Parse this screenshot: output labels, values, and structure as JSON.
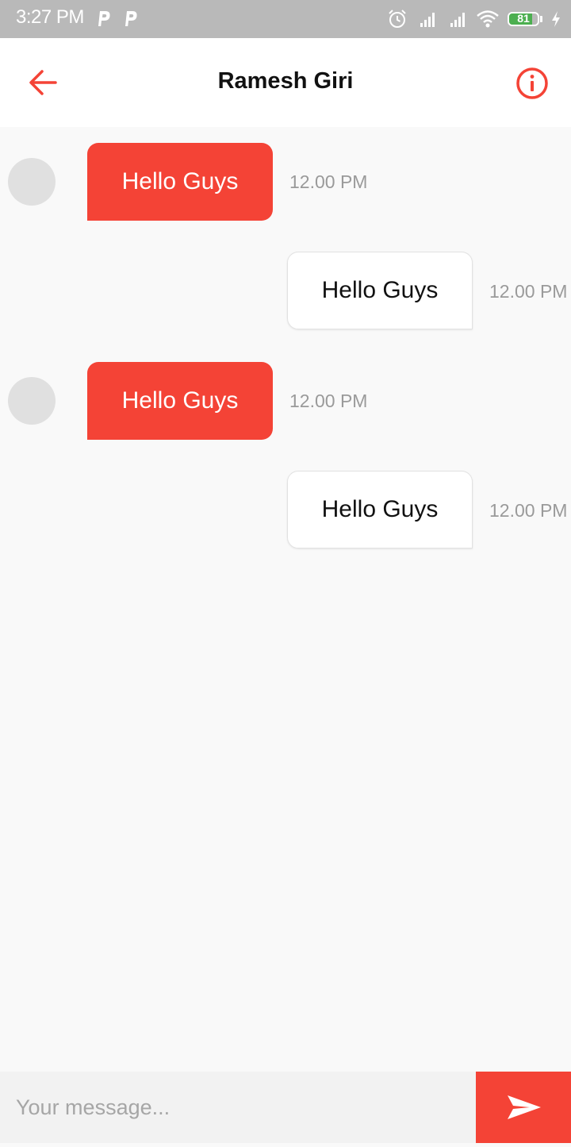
{
  "status_bar": {
    "time": "3:27 PM",
    "battery_level": "81"
  },
  "header": {
    "title": "Ramesh Giri",
    "back_icon": "arrow-left-icon",
    "info_icon": "info-circle-icon"
  },
  "messages": [
    {
      "direction": "incoming",
      "text": "Hello Guys",
      "time": "12.00 PM"
    },
    {
      "direction": "outgoing",
      "text": "Hello Guys",
      "time": "12.00 PM"
    },
    {
      "direction": "incoming",
      "text": "Hello Guys",
      "time": "12.00 PM"
    },
    {
      "direction": "outgoing",
      "text": "Hello Guys",
      "time": "12.00 PM"
    }
  ],
  "composer": {
    "placeholder": "Your message...",
    "value": "",
    "send_icon": "send-icon"
  },
  "colors": {
    "accent": "#f44336",
    "status_bar": "#b9b9b9",
    "background": "#f9f9f9",
    "avatar": "#e0e0e0",
    "battery": "#4caf50"
  }
}
